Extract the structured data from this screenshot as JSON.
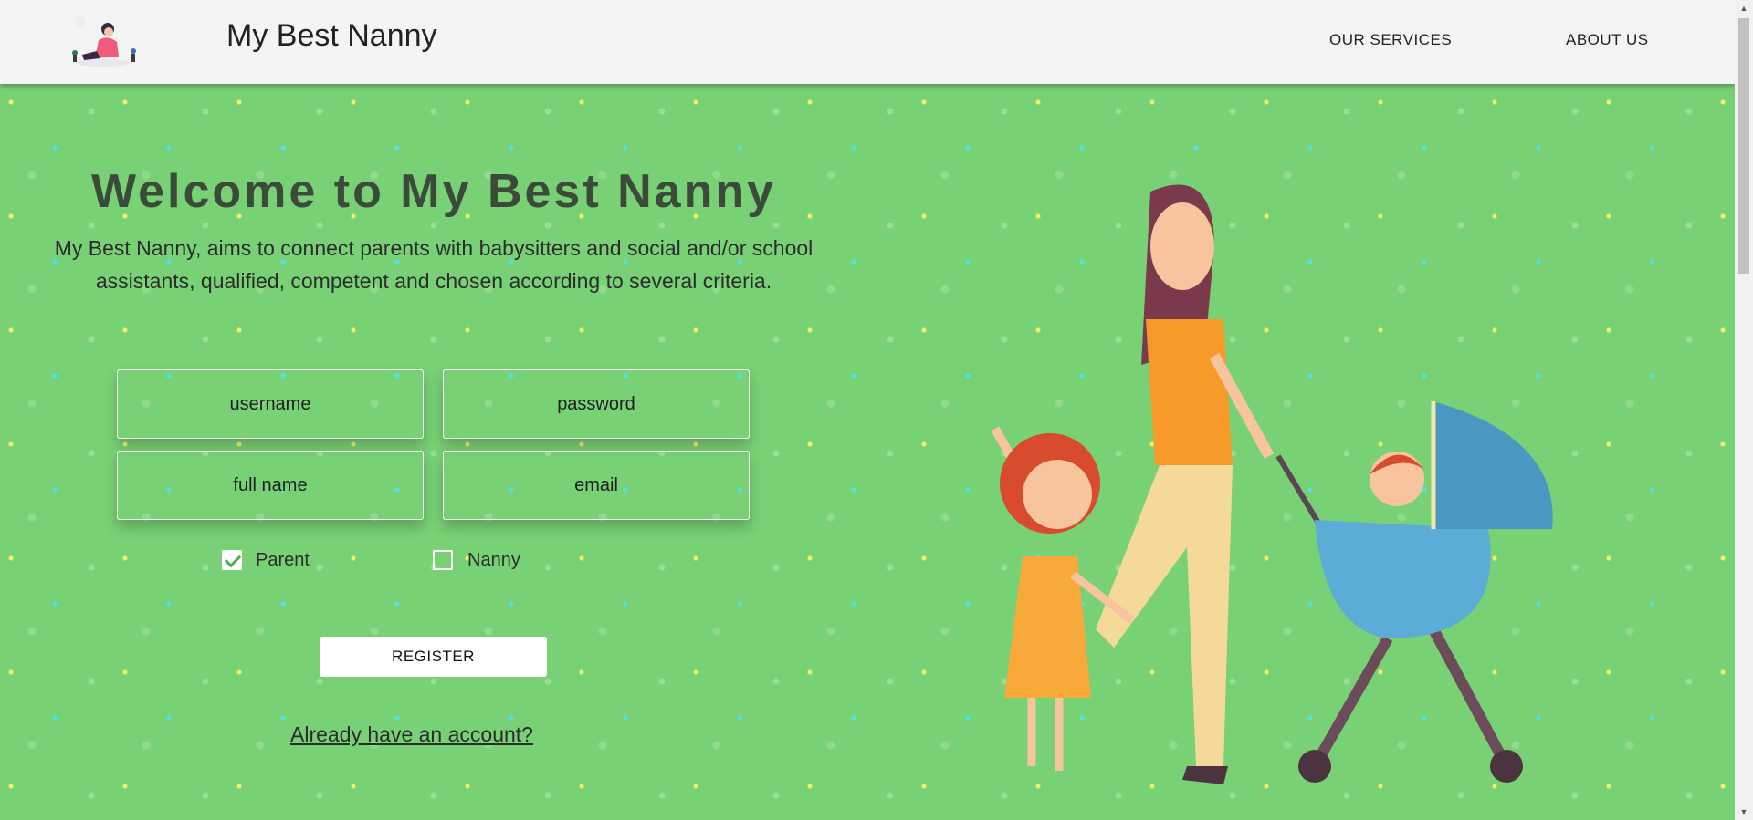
{
  "header": {
    "brand": "My Best Nanny",
    "nav": {
      "services": "OUR SERVICES",
      "about": "ABOUT US"
    }
  },
  "hero": {
    "title": "Welcome to My Best Nanny",
    "description": "My Best Nanny, aims to connect parents with babysitters and social and/or school assistants, qualified, competent and chosen according to several criteria."
  },
  "form": {
    "username_placeholder": "username",
    "password_placeholder": "password",
    "fullname_placeholder": "full name",
    "email_placeholder": "email",
    "role_parent": {
      "label": "Parent",
      "checked": true
    },
    "role_nanny": {
      "label": "Nanny",
      "checked": false
    },
    "register_label": "REGISTER",
    "login_link": "Already have an account?"
  },
  "icons": {
    "logo": "nanny-logo-icon",
    "checkbox_checked": "checkmark-icon"
  },
  "colors": {
    "background": "#78d174",
    "header": "#f4f4f4",
    "title": "#3c4a3a",
    "stroller": "#5bacd6",
    "dress": "#f7a93a"
  }
}
